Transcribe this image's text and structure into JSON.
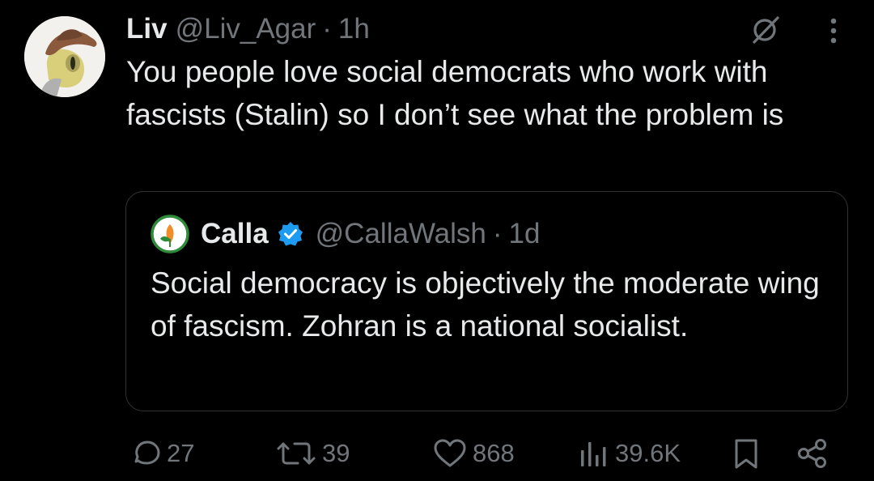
{
  "post": {
    "display_name": "Liv",
    "handle": "@Liv_Agar",
    "separator": "·",
    "time": "1h",
    "text": "You people love social democrats who work with fascists (Stalin) so I don’t see what the problem is"
  },
  "quoted_post": {
    "display_name": "Calla",
    "handle": "@CallaWalsh",
    "separator": "·",
    "time": "1d",
    "text": "Social democracy is objectively the moderate wing of fascism. Zohran is a national socialist."
  },
  "actions": {
    "replies": "27",
    "reposts": "39",
    "likes": "868",
    "views": "39.6K"
  },
  "colors": {
    "background": "#000000",
    "text": "#e7e9ea",
    "muted": "#71767b",
    "verified": "#1d9bf0",
    "border": "#2f3336"
  },
  "icons": [
    "grok-icon",
    "more-icon",
    "reply-icon",
    "repost-icon",
    "like-icon",
    "views-icon",
    "bookmark-icon",
    "share-icon",
    "verified-badge-icon"
  ]
}
